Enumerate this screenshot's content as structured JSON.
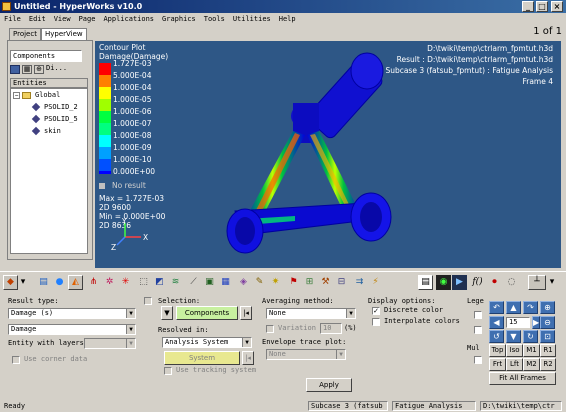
{
  "window": {
    "title": "Untitled - HyperWorks v10.0",
    "minimize": "_",
    "maximize": "□",
    "close": "×"
  },
  "menu": [
    "File",
    "Edit",
    "View",
    "Page",
    "Applications",
    "Graphics",
    "Tools",
    "Utilities",
    "Help"
  ],
  "page_indicator": "1 of 1",
  "browser": {
    "tabs": [
      "Project",
      "HyperView"
    ],
    "filter_value": "Components",
    "toolbar_label": "Di...",
    "entities_header": "Entities",
    "tree": [
      "Global",
      "PSOLID_2",
      "PSOLID_5",
      "skin"
    ]
  },
  "viewport": {
    "contour_title": "Contour Plot",
    "contour_type": "Damage(Damage)",
    "legend": [
      {
        "label": "1.727E-03",
        "color": "#ff0000"
      },
      {
        "label": "5.000E-04",
        "color": "#ff8000"
      },
      {
        "label": "1.000E-04",
        "color": "#ffff00"
      },
      {
        "label": "1.000E-05",
        "color": "#a0ff00"
      },
      {
        "label": "1.000E-06",
        "color": "#00ff40"
      },
      {
        "label": "1.000E-07",
        "color": "#00ff80"
      },
      {
        "label": "1.000E-08",
        "color": "#00ffff"
      },
      {
        "label": "1.000E-09",
        "color": "#00a0ff"
      },
      {
        "label": "1.000E-10",
        "color": "#0050ff"
      },
      {
        "label": "0.000E+00",
        "color": "#0000ff"
      }
    ],
    "no_result": "No result",
    "max_line": "Max = 1.727E-03",
    "max_elem": "2D 9600",
    "min_line": "Min = 0.000E+00",
    "min_elem": "2D 8636",
    "file_path": "D:\\twiki\\temp\\ctrlarm_fpmtut.h3d",
    "result_path": "Result : D:\\twiki\\temp\\ctrlarm_fpmtut.h3d",
    "subcase": "Subcase 3 (fatsub_fpmtut) : Fatigue Analysis",
    "frame": "Frame 4",
    "triad_x": "X",
    "triad_y": "Y",
    "triad_z": "Z"
  },
  "controls": {
    "result_type_label": "Result type:",
    "result_type_value": "Damage (s)",
    "result_component_value": "Damage",
    "entity_layers_label": "Entity with layers:",
    "use_corner_data": "Use corner data",
    "selection_label": "Selection:",
    "selection_value": "Components",
    "resolved_in_label": "Resolved in:",
    "resolved_in_value": "Analysis System",
    "system_button": "System",
    "use_tracking_system": "Use tracking system",
    "averaging_label": "Averaging method:",
    "averaging_value": "None",
    "variation_label": "Variation <",
    "variation_value": "10",
    "variation_unit": "(%)",
    "envelope_label": "Envelope trace plot:",
    "envelope_value": "None",
    "apply": "Apply",
    "display_options_label": "Display options:",
    "discrete_color": "Discrete color",
    "interpolate_colors": "Interpolate colors",
    "legend_label": "Lege",
    "multiple_label": "Mul",
    "zoom_value": "15",
    "view_buttons": [
      "Top",
      "Iso",
      "M1",
      "R1",
      "Frt",
      "Lft",
      "M2",
      "R2"
    ],
    "fit_all_frames": "Fit All Frames"
  },
  "status": {
    "ready": "Ready",
    "subcase": "Subcase 3 (fatsub",
    "analysis": "Fatigue Analysis",
    "path": "D:\\twiki\\temp\\ctr"
  }
}
